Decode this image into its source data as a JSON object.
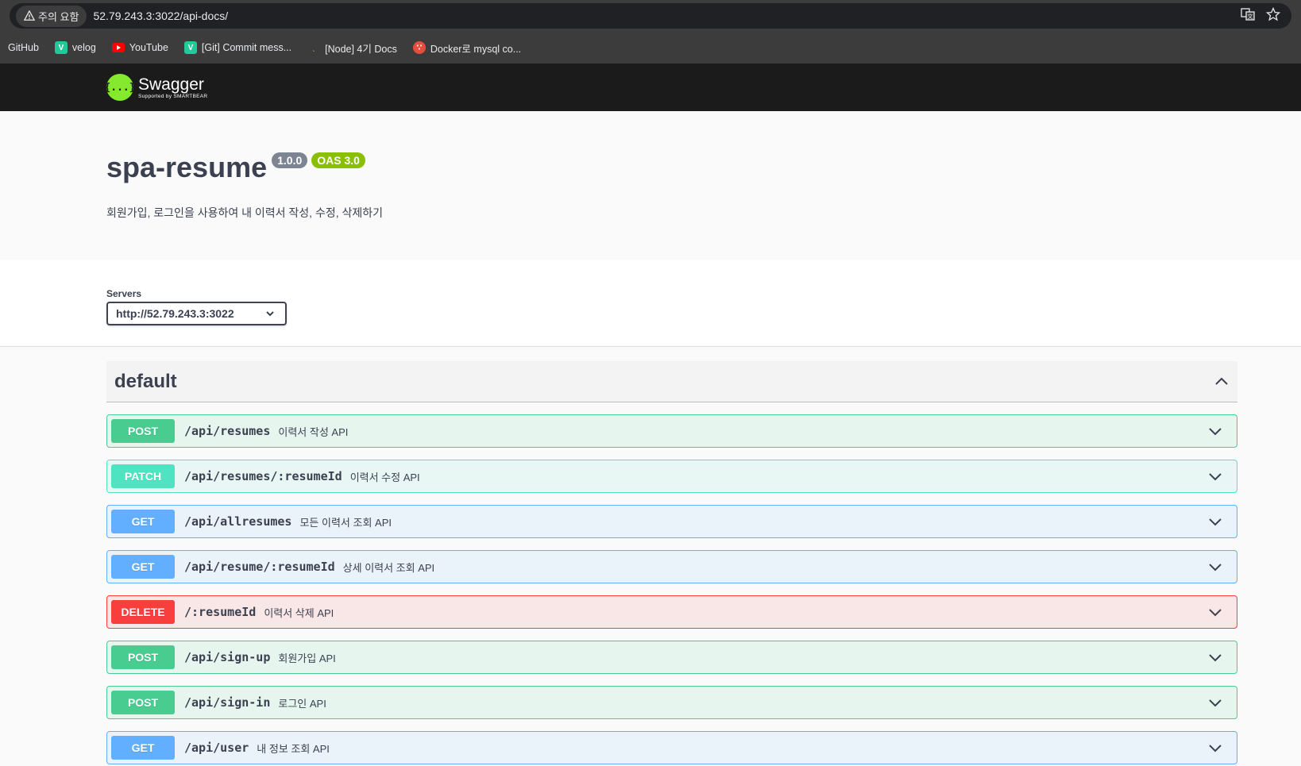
{
  "browser": {
    "warning_label": "주의 요함",
    "url": "52.79.243.3:3022/api-docs/",
    "icons": [
      "translate-icon",
      "star-icon"
    ],
    "bookmarks": [
      {
        "label": "GitHub",
        "icon": "github-icon"
      },
      {
        "label": "velog",
        "icon": "velog-icon"
      },
      {
        "label": "YouTube",
        "icon": "youtube-icon"
      },
      {
        "label": "[Git] Commit mess...",
        "icon": "velog-icon"
      },
      {
        "label": "[Node] 4기 Docs",
        "icon": "node-icon"
      },
      {
        "label": "Docker로 mysql co...",
        "icon": "docker-icon"
      }
    ]
  },
  "topbar": {
    "logo_mark": "{...}",
    "logo_name": "Swagger",
    "logo_sub": "Supported by SMARTBEAR"
  },
  "info": {
    "title": "spa-resume",
    "version": "1.0.0",
    "oas": "OAS 3.0",
    "description": "회원가입, 로그인을 사용하여 내 이력서 작성, 수정, 삭제하기"
  },
  "servers": {
    "label": "Servers",
    "selected": "http://52.79.243.3:3022"
  },
  "tag": {
    "name": "default"
  },
  "operations": [
    {
      "method": "POST",
      "path": "/api/resumes",
      "summary": "이력서 작성 API"
    },
    {
      "method": "PATCH",
      "path": "/api/resumes/:resumeId",
      "summary": "이력서 수정 API"
    },
    {
      "method": "GET",
      "path": "/api/allresumes",
      "summary": "모든 이력서 조회 API"
    },
    {
      "method": "GET",
      "path": "/api/resume/:resumeId",
      "summary": "상세 이력서 조회 API"
    },
    {
      "method": "DELETE",
      "path": "/:resumeId",
      "summary": "이력서 삭제 API"
    },
    {
      "method": "POST",
      "path": "/api/sign-up",
      "summary": "회원가입 API"
    },
    {
      "method": "POST",
      "path": "/api/sign-in",
      "summary": "로그인 API"
    },
    {
      "method": "GET",
      "path": "/api/user",
      "summary": "내 정보 조회 API"
    }
  ],
  "colors": {
    "post": "#49cc90",
    "patch": "#50e3c2",
    "get": "#61affe",
    "delete": "#f93e3e",
    "topbar": "#1b1b1b",
    "logo": "#85ea2d"
  }
}
